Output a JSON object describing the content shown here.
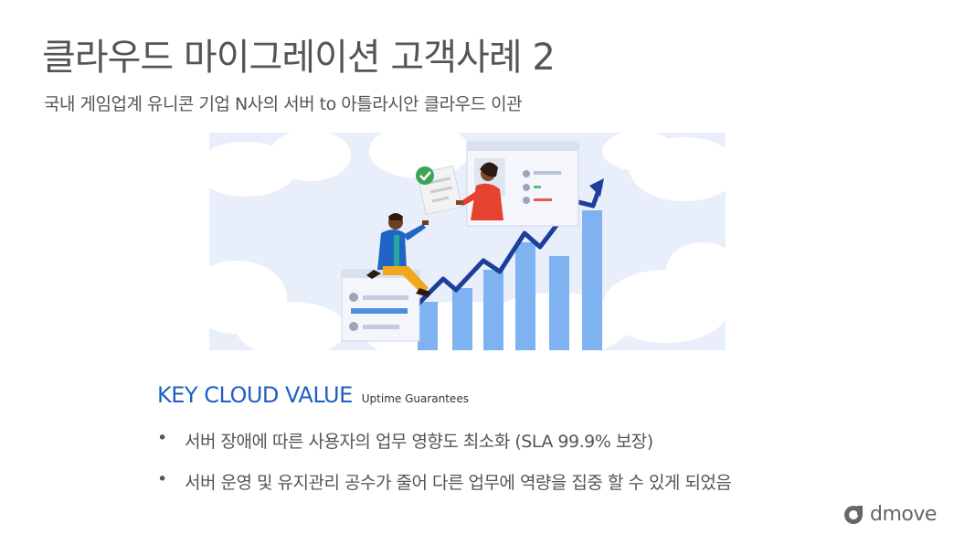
{
  "slide": {
    "title": "클라우드 마이그레이션 고객사례 2",
    "subtitle": "국내 게임업계 유니콘 기업 N사의 서버 to 아틀라시안 클라우드 이관"
  },
  "key_value": {
    "heading": "KEY CLOUD VALUE",
    "tag": "Uptime Guarantees",
    "bullets": [
      "서버 장애에 따른 사용자의 업무 영향도 최소화 (SLA 99.9% 보장)",
      "서버 운영 및 유지관리 공수가 줄어 다른 업무에 역량을 집중 할 수 있게 되었음"
    ],
    "bullet_symbol": "•"
  },
  "logo": {
    "text": "dmove"
  },
  "colors": {
    "title_gray": "#555555",
    "accent_blue": "#1f5fbf",
    "chart_bar": "#7fb2f0",
    "arrow_navy": "#1d3f9a",
    "sky": "#e6eefc"
  },
  "icons": [
    "check-icon",
    "logo-icon"
  ]
}
